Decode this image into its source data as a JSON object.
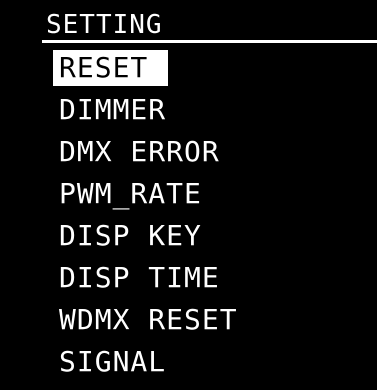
{
  "colors": {
    "background": "#000000",
    "foreground": "#ffffff",
    "highlight_bg": "#ffffff",
    "highlight_fg": "#000000"
  },
  "menu": {
    "title": "SETTING",
    "selected_index": 0,
    "items": [
      {
        "label": "RESET"
      },
      {
        "label": "DIMMER"
      },
      {
        "label": "DMX ERROR"
      },
      {
        "label": "PWM_RATE"
      },
      {
        "label": "DISP KEY"
      },
      {
        "label": "DISP TIME"
      },
      {
        "label": "WDMX RESET"
      },
      {
        "label": "SIGNAL"
      }
    ]
  }
}
